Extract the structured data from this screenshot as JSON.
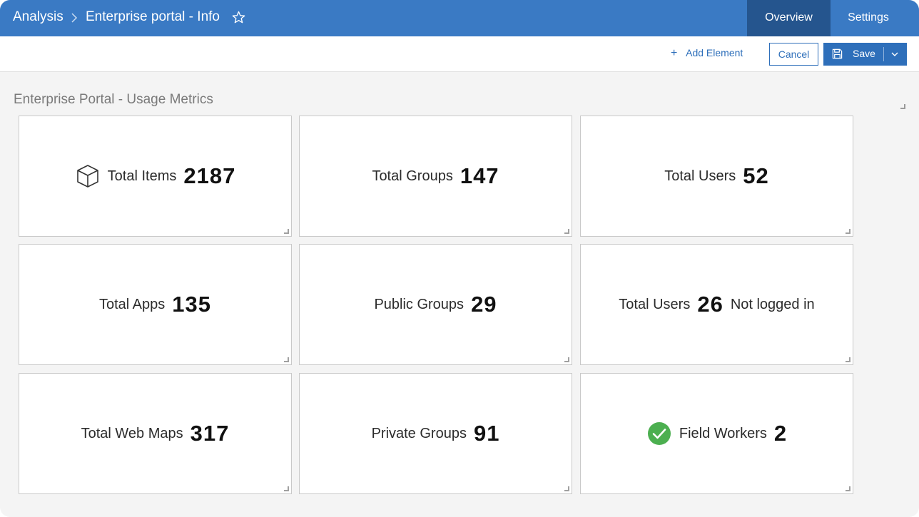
{
  "header": {
    "breadcrumb_root": "Analysis",
    "breadcrumb_title": "Enterprise portal - Info",
    "tabs": [
      {
        "label": "Overview",
        "active": true
      },
      {
        "label": "Settings",
        "active": false
      }
    ],
    "accent_color": "#3a7ac4",
    "active_tab_color": "#25558e"
  },
  "toolbar": {
    "add_element_label": "Add Element",
    "cancel_label": "Cancel",
    "save_label": "Save"
  },
  "section": {
    "title": "Enterprise Portal - Usage Metrics"
  },
  "cards": [
    {
      "label": "Total Items",
      "value": "2187",
      "suffix": "",
      "icon": "cube-icon"
    },
    {
      "label": "Total Groups",
      "value": "147",
      "suffix": "",
      "icon": ""
    },
    {
      "label": "Total Users",
      "value": "52",
      "suffix": "",
      "icon": ""
    },
    {
      "label": "Total Apps",
      "value": "135",
      "suffix": "",
      "icon": ""
    },
    {
      "label": "Public Groups",
      "value": "29",
      "suffix": "",
      "icon": ""
    },
    {
      "label": "Total Users",
      "value": "26",
      "suffix": "Not logged in",
      "icon": ""
    },
    {
      "label": "Total Web Maps",
      "value": "317",
      "suffix": "",
      "icon": ""
    },
    {
      "label": "Private Groups",
      "value": "91",
      "suffix": "",
      "icon": ""
    },
    {
      "label": "Field Workers",
      "value": "2",
      "suffix": "",
      "icon": "check-circle-icon",
      "icon_color": "#4caf50"
    }
  ]
}
